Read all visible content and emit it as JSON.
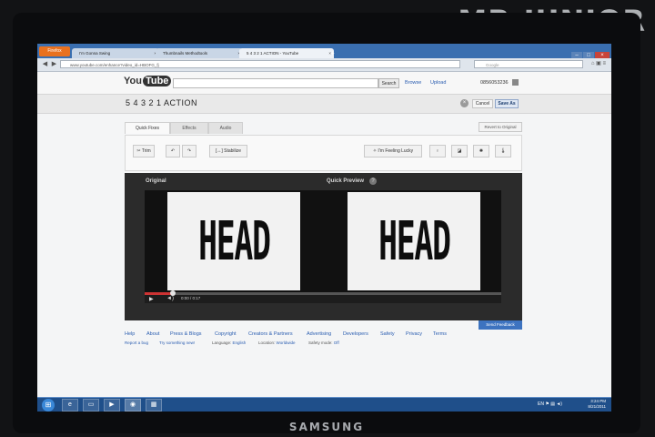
{
  "watermark": "MR.JUNIOR",
  "monitor_brand": "SAMSUNG",
  "browser": {
    "app_button": "Firefox",
    "tabs": [
      {
        "label": "I'm Gonna Swing"
      },
      {
        "label": "Thumbnails Methodtools"
      },
      {
        "label": "5 4 3 2 1 ACTION - YouTube"
      }
    ],
    "new_tab": "+",
    "url": "www.youtube.com/enhance?video_id=HBOFG_fj",
    "search_placeholder": "Google"
  },
  "youtube": {
    "logo_you": "You",
    "logo_tube": "Tube",
    "search_button": "Search",
    "browse": "Browse",
    "upload": "Upload",
    "username": "0856053236",
    "video_title": "5 4 3 2 1 ACTION",
    "cancel": "Cancel",
    "save_as": "Save As",
    "tabs": [
      {
        "label": "Quick Fixes"
      },
      {
        "label": "Effects"
      },
      {
        "label": "Audio"
      }
    ],
    "revert": "Revert to Original",
    "tools": {
      "trim": "Trim",
      "stabilize": "Stabilize",
      "feeling_lucky": "I'm Feeling Lucky"
    },
    "player": {
      "original_label": "Original",
      "preview_label": "Quick Preview",
      "help": "?",
      "frame_text": "HEAD",
      "time": "0:00 / 0:17",
      "progress": 0.08
    },
    "send_feedback": "Send Feedback",
    "footer_links": [
      "Help",
      "About",
      "Press & Blogs",
      "Copyright",
      "Creators & Partners",
      "Advertising",
      "Developers",
      "Safety",
      "Privacy",
      "Terms"
    ],
    "footer_sub": {
      "report": "Report a bug",
      "try_new": "Try something new!",
      "language_label": "Language:",
      "language_value": "English",
      "location_label": "Location:",
      "location_value": "Worldwide",
      "safety_label": "Safety mode:",
      "safety_value": "Off"
    }
  },
  "taskbar": {
    "lang": "EN",
    "time": "3:24 PM",
    "date": "8/21/2011"
  }
}
